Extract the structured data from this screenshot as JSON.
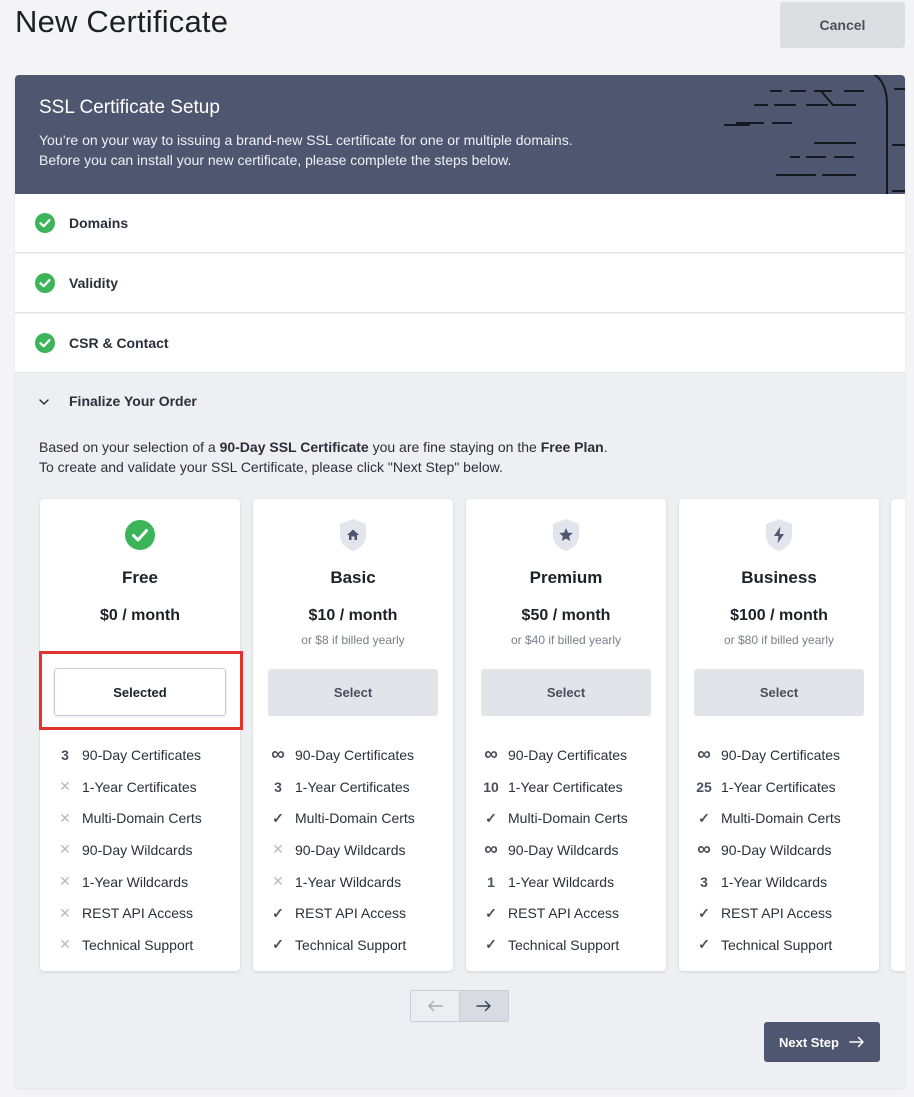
{
  "header": {
    "title": "New Certificate",
    "cancel_label": "Cancel"
  },
  "banner": {
    "title": "SSL Certificate Setup",
    "line1": "You’re on your way to issuing a brand-new SSL certificate for one or multiple domains.",
    "line2": "Before you can install your new certificate, please complete the steps below."
  },
  "steps": [
    {
      "label": "Domains",
      "status": "complete"
    },
    {
      "label": "Validity",
      "status": "complete"
    },
    {
      "label": "CSR & Contact",
      "status": "complete"
    }
  ],
  "finalize": {
    "label": "Finalize Your Order",
    "info_prefix": "Based on your selection of a ",
    "info_cert": "90-Day SSL Certificate",
    "info_mid": " you are fine staying on the ",
    "info_plan": "Free Plan",
    "info_end": ".",
    "info_line2": "To create and validate your SSL Certificate, please click \"Next Step\" below."
  },
  "plans": [
    {
      "name": "Free",
      "price": "$0 / month",
      "yearly": "",
      "button": "Selected",
      "selected": true,
      "icon": "check-circle-icon",
      "features": [
        {
          "mark": "3",
          "kind": "num",
          "label": "90-Day Certificates"
        },
        {
          "mark": "✕",
          "kind": "cross",
          "label": "1-Year Certificates"
        },
        {
          "mark": "✕",
          "kind": "cross",
          "label": "Multi-Domain Certs"
        },
        {
          "mark": "✕",
          "kind": "cross",
          "label": "90-Day Wildcards"
        },
        {
          "mark": "✕",
          "kind": "cross",
          "label": "1-Year Wildcards"
        },
        {
          "mark": "✕",
          "kind": "cross",
          "label": "REST API Access"
        },
        {
          "mark": "✕",
          "kind": "cross",
          "label": "Technical Support"
        }
      ]
    },
    {
      "name": "Basic",
      "price": "$10 / month",
      "yearly": "or $8 if billed yearly",
      "button": "Select",
      "selected": false,
      "icon": "shield-home-icon",
      "features": [
        {
          "mark": "∞",
          "kind": "inf",
          "label": "90-Day Certificates"
        },
        {
          "mark": "3",
          "kind": "num",
          "label": "1-Year Certificates"
        },
        {
          "mark": "✓",
          "kind": "check",
          "label": "Multi-Domain Certs"
        },
        {
          "mark": "✕",
          "kind": "cross",
          "label": "90-Day Wildcards"
        },
        {
          "mark": "✕",
          "kind": "cross",
          "label": "1-Year Wildcards"
        },
        {
          "mark": "✓",
          "kind": "check",
          "label": "REST API Access"
        },
        {
          "mark": "✓",
          "kind": "check",
          "label": "Technical Support"
        }
      ]
    },
    {
      "name": "Premium",
      "price": "$50 / month",
      "yearly": "or $40 if billed yearly",
      "button": "Select",
      "selected": false,
      "icon": "shield-star-icon",
      "features": [
        {
          "mark": "∞",
          "kind": "inf",
          "label": "90-Day Certificates"
        },
        {
          "mark": "10",
          "kind": "num",
          "label": "1-Year Certificates"
        },
        {
          "mark": "✓",
          "kind": "check",
          "label": "Multi-Domain Certs"
        },
        {
          "mark": "∞",
          "kind": "inf",
          "label": "90-Day Wildcards"
        },
        {
          "mark": "1",
          "kind": "num",
          "label": "1-Year Wildcards"
        },
        {
          "mark": "✓",
          "kind": "check",
          "label": "REST API Access"
        },
        {
          "mark": "✓",
          "kind": "check",
          "label": "Technical Support"
        }
      ]
    },
    {
      "name": "Business",
      "price": "$100 / month",
      "yearly": "or $80 if billed yearly",
      "button": "Select",
      "selected": false,
      "icon": "shield-bolt-icon",
      "features": [
        {
          "mark": "∞",
          "kind": "inf",
          "label": "90-Day Certificates"
        },
        {
          "mark": "25",
          "kind": "num",
          "label": "1-Year Certificates"
        },
        {
          "mark": "✓",
          "kind": "check",
          "label": "Multi-Domain Certs"
        },
        {
          "mark": "∞",
          "kind": "inf",
          "label": "90-Day Wildcards"
        },
        {
          "mark": "3",
          "kind": "num",
          "label": "1-Year Wildcards"
        },
        {
          "mark": "✓",
          "kind": "check",
          "label": "REST API Access"
        },
        {
          "mark": "✓",
          "kind": "check",
          "label": "Technical Support"
        }
      ]
    }
  ],
  "footer": {
    "next_step_label": "Next Step"
  },
  "colors": {
    "banner": "#4f566f",
    "check_green": "#3cb55a",
    "highlight_red": "#e2332e"
  }
}
